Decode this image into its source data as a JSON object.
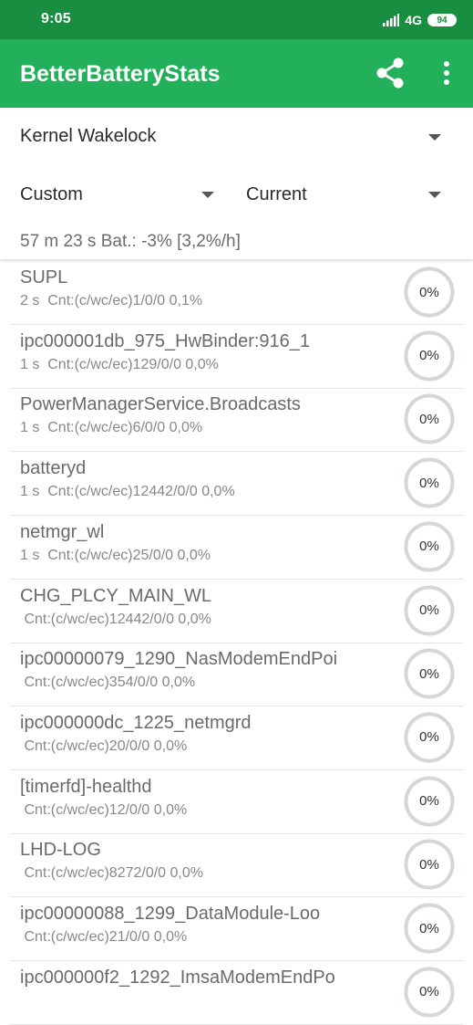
{
  "status_bar": {
    "time": "9:05",
    "network": "4G",
    "battery_level": "94"
  },
  "app_bar": {
    "title": "BetterBatteryStats",
    "share_icon": "share-icon",
    "more_icon": "more-vertical-icon"
  },
  "filters": {
    "stat_type": "Kernel Wakelock",
    "from_ref": "Custom",
    "to_ref": "Current"
  },
  "summary": "57 m 23 s  Bat.: -3% [3,2%/h]",
  "items": [
    {
      "name": "SUPL",
      "detail": "2 s  Cnt:(c/wc/ec)1/0/0 0,1%",
      "percent": "0%"
    },
    {
      "name": "ipc000001db_975_HwBinder:916_1",
      "detail": "1 s  Cnt:(c/wc/ec)129/0/0 0,0%",
      "percent": "0%"
    },
    {
      "name": "PowerManagerService.Broadcasts",
      "detail": "1 s  Cnt:(c/wc/ec)6/0/0 0,0%",
      "percent": "0%"
    },
    {
      "name": "batteryd",
      "detail": "1 s  Cnt:(c/wc/ec)12442/0/0 0,0%",
      "percent": "0%"
    },
    {
      "name": "netmgr_wl",
      "detail": "1 s  Cnt:(c/wc/ec)25/0/0 0,0%",
      "percent": "0%"
    },
    {
      "name": "CHG_PLCY_MAIN_WL",
      "detail": " Cnt:(c/wc/ec)12442/0/0 0,0%",
      "percent": "0%"
    },
    {
      "name": "ipc00000079_1290_NasModemEndPoi",
      "detail": " Cnt:(c/wc/ec)354/0/0 0,0%",
      "percent": "0%"
    },
    {
      "name": "ipc000000dc_1225_netmgrd",
      "detail": " Cnt:(c/wc/ec)20/0/0 0,0%",
      "percent": "0%"
    },
    {
      "name": "[timerfd]-healthd",
      "detail": " Cnt:(c/wc/ec)12/0/0 0,0%",
      "percent": "0%"
    },
    {
      "name": "LHD-LOG",
      "detail": " Cnt:(c/wc/ec)8272/0/0 0,0%",
      "percent": "0%"
    },
    {
      "name": "ipc00000088_1299_DataModule-Loo",
      "detail": " Cnt:(c/wc/ec)21/0/0 0,0%",
      "percent": "0%"
    },
    {
      "name": "ipc000000f2_1292_ImsaModemEndPo",
      "detail": "",
      "percent": "0%"
    }
  ],
  "colors": {
    "status_bar": "#178e40",
    "app_bar": "#22b05a",
    "gauge_ring": "#d3d8d4"
  }
}
